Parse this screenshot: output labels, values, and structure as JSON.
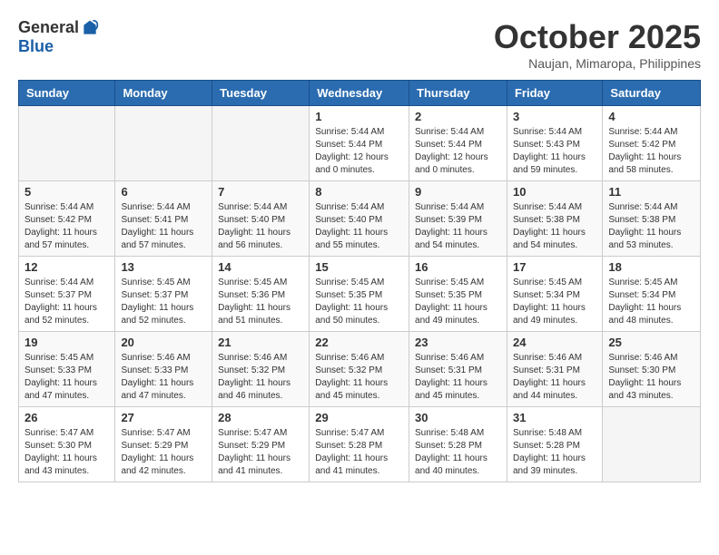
{
  "logo": {
    "general": "General",
    "blue": "Blue"
  },
  "title": "October 2025",
  "location": "Naujan, Mimaropa, Philippines",
  "days_of_week": [
    "Sunday",
    "Monday",
    "Tuesday",
    "Wednesday",
    "Thursday",
    "Friday",
    "Saturday"
  ],
  "weeks": [
    [
      {
        "day": "",
        "info": ""
      },
      {
        "day": "",
        "info": ""
      },
      {
        "day": "",
        "info": ""
      },
      {
        "day": "1",
        "info": "Sunrise: 5:44 AM\nSunset: 5:44 PM\nDaylight: 12 hours\nand 0 minutes."
      },
      {
        "day": "2",
        "info": "Sunrise: 5:44 AM\nSunset: 5:44 PM\nDaylight: 12 hours\nand 0 minutes."
      },
      {
        "day": "3",
        "info": "Sunrise: 5:44 AM\nSunset: 5:43 PM\nDaylight: 11 hours\nand 59 minutes."
      },
      {
        "day": "4",
        "info": "Sunrise: 5:44 AM\nSunset: 5:42 PM\nDaylight: 11 hours\nand 58 minutes."
      }
    ],
    [
      {
        "day": "5",
        "info": "Sunrise: 5:44 AM\nSunset: 5:42 PM\nDaylight: 11 hours\nand 57 minutes."
      },
      {
        "day": "6",
        "info": "Sunrise: 5:44 AM\nSunset: 5:41 PM\nDaylight: 11 hours\nand 57 minutes."
      },
      {
        "day": "7",
        "info": "Sunrise: 5:44 AM\nSunset: 5:40 PM\nDaylight: 11 hours\nand 56 minutes."
      },
      {
        "day": "8",
        "info": "Sunrise: 5:44 AM\nSunset: 5:40 PM\nDaylight: 11 hours\nand 55 minutes."
      },
      {
        "day": "9",
        "info": "Sunrise: 5:44 AM\nSunset: 5:39 PM\nDaylight: 11 hours\nand 54 minutes."
      },
      {
        "day": "10",
        "info": "Sunrise: 5:44 AM\nSunset: 5:38 PM\nDaylight: 11 hours\nand 54 minutes."
      },
      {
        "day": "11",
        "info": "Sunrise: 5:44 AM\nSunset: 5:38 PM\nDaylight: 11 hours\nand 53 minutes."
      }
    ],
    [
      {
        "day": "12",
        "info": "Sunrise: 5:44 AM\nSunset: 5:37 PM\nDaylight: 11 hours\nand 52 minutes."
      },
      {
        "day": "13",
        "info": "Sunrise: 5:45 AM\nSunset: 5:37 PM\nDaylight: 11 hours\nand 52 minutes."
      },
      {
        "day": "14",
        "info": "Sunrise: 5:45 AM\nSunset: 5:36 PM\nDaylight: 11 hours\nand 51 minutes."
      },
      {
        "day": "15",
        "info": "Sunrise: 5:45 AM\nSunset: 5:35 PM\nDaylight: 11 hours\nand 50 minutes."
      },
      {
        "day": "16",
        "info": "Sunrise: 5:45 AM\nSunset: 5:35 PM\nDaylight: 11 hours\nand 49 minutes."
      },
      {
        "day": "17",
        "info": "Sunrise: 5:45 AM\nSunset: 5:34 PM\nDaylight: 11 hours\nand 49 minutes."
      },
      {
        "day": "18",
        "info": "Sunrise: 5:45 AM\nSunset: 5:34 PM\nDaylight: 11 hours\nand 48 minutes."
      }
    ],
    [
      {
        "day": "19",
        "info": "Sunrise: 5:45 AM\nSunset: 5:33 PM\nDaylight: 11 hours\nand 47 minutes."
      },
      {
        "day": "20",
        "info": "Sunrise: 5:46 AM\nSunset: 5:33 PM\nDaylight: 11 hours\nand 47 minutes."
      },
      {
        "day": "21",
        "info": "Sunrise: 5:46 AM\nSunset: 5:32 PM\nDaylight: 11 hours\nand 46 minutes."
      },
      {
        "day": "22",
        "info": "Sunrise: 5:46 AM\nSunset: 5:32 PM\nDaylight: 11 hours\nand 45 minutes."
      },
      {
        "day": "23",
        "info": "Sunrise: 5:46 AM\nSunset: 5:31 PM\nDaylight: 11 hours\nand 45 minutes."
      },
      {
        "day": "24",
        "info": "Sunrise: 5:46 AM\nSunset: 5:31 PM\nDaylight: 11 hours\nand 44 minutes."
      },
      {
        "day": "25",
        "info": "Sunrise: 5:46 AM\nSunset: 5:30 PM\nDaylight: 11 hours\nand 43 minutes."
      }
    ],
    [
      {
        "day": "26",
        "info": "Sunrise: 5:47 AM\nSunset: 5:30 PM\nDaylight: 11 hours\nand 43 minutes."
      },
      {
        "day": "27",
        "info": "Sunrise: 5:47 AM\nSunset: 5:29 PM\nDaylight: 11 hours\nand 42 minutes."
      },
      {
        "day": "28",
        "info": "Sunrise: 5:47 AM\nSunset: 5:29 PM\nDaylight: 11 hours\nand 41 minutes."
      },
      {
        "day": "29",
        "info": "Sunrise: 5:47 AM\nSunset: 5:28 PM\nDaylight: 11 hours\nand 41 minutes."
      },
      {
        "day": "30",
        "info": "Sunrise: 5:48 AM\nSunset: 5:28 PM\nDaylight: 11 hours\nand 40 minutes."
      },
      {
        "day": "31",
        "info": "Sunrise: 5:48 AM\nSunset: 5:28 PM\nDaylight: 11 hours\nand 39 minutes."
      },
      {
        "day": "",
        "info": ""
      }
    ]
  ]
}
